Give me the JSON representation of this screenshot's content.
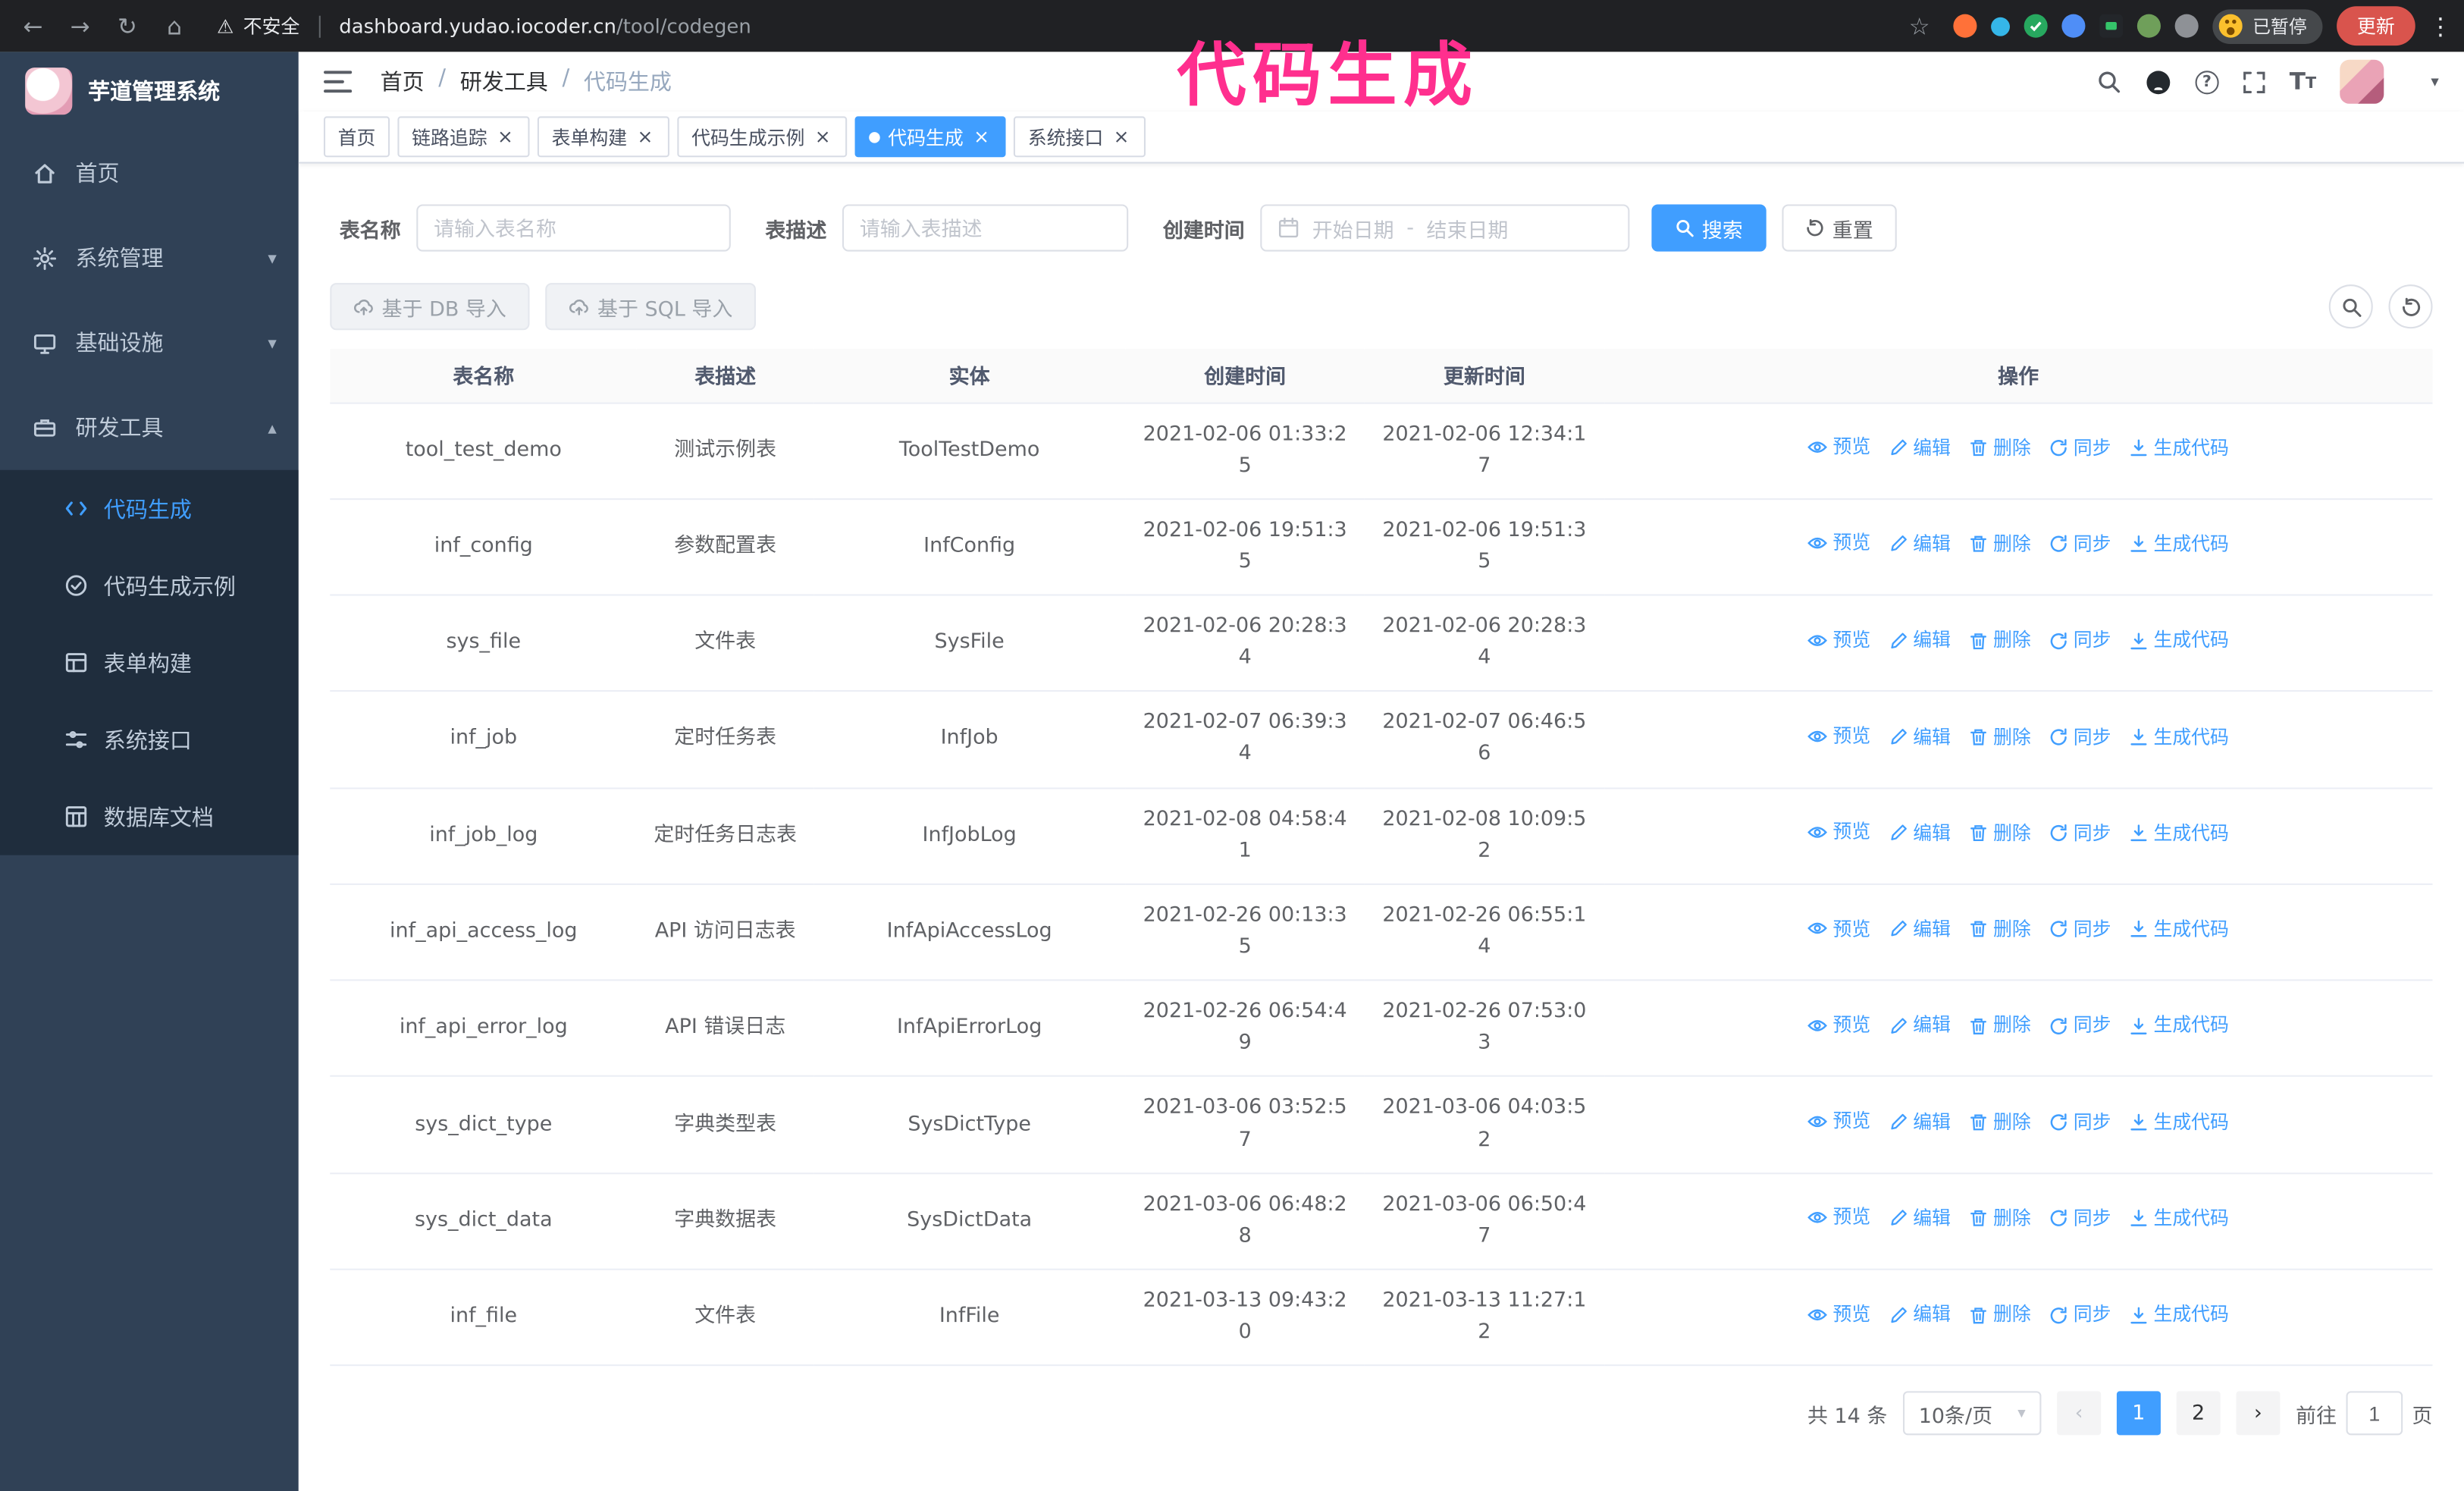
{
  "theme": {
    "accent_blue": "#409EFF",
    "sidebar_bg": "#304156",
    "submenu_bg": "#1f2d3d",
    "chrome_bg": "#202124",
    "overlay_pink": "#ff2f8e",
    "update_red": "#d9544d",
    "link_blue": "#409EFF"
  },
  "glyphs": {
    "back": "←",
    "forward": "→",
    "reload": "↻",
    "home": "⌂",
    "warning": "⚠",
    "star": "☆",
    "menu_dots": "⋮",
    "chevron_down": "▾",
    "chevron_up": "▴",
    "close": "×",
    "prev": "‹",
    "next": "›",
    "question": "?",
    "letter_t": "T"
  },
  "browser": {
    "security_label": "不安全",
    "url_host": "dashboard.yudao.iocoder.cn",
    "url_path": "/tool/codegen",
    "paused_badge": "已暂停",
    "update_button": "更新"
  },
  "overlay": {
    "title": "代码生成"
  },
  "sidebar": {
    "logo_title": "芋道管理系统",
    "items": [
      {
        "label": "首页",
        "icon": "home-icon"
      },
      {
        "label": "系统管理",
        "icon": "gear-icon"
      },
      {
        "label": "基础设施",
        "icon": "monitor-icon"
      },
      {
        "label": "研发工具",
        "icon": "toolbox-icon"
      }
    ],
    "sub_items": [
      {
        "label": "代码生成",
        "icon": "code-icon"
      },
      {
        "label": "代码生成示例",
        "icon": "circle-check-icon"
      },
      {
        "label": "表单构建",
        "icon": "form-icon"
      },
      {
        "label": "系统接口",
        "icon": "sliders-icon"
      },
      {
        "label": "数据库文档",
        "icon": "grid-icon"
      }
    ]
  },
  "header": {
    "breadcrumb": [
      "首页",
      "研发工具",
      "代码生成"
    ],
    "separator": "/"
  },
  "tabs": [
    {
      "label": "首页"
    },
    {
      "label": "链路追踪"
    },
    {
      "label": "表单构建"
    },
    {
      "label": "代码生成示例"
    },
    {
      "label": "代码生成"
    },
    {
      "label": "系统接口"
    }
  ],
  "filters": {
    "name_label": "表名称",
    "name_placeholder": "请输入表名称",
    "desc_label": "表描述",
    "desc_placeholder": "请输入表描述",
    "time_label": "创建时间",
    "start_placeholder": "开始日期",
    "range_separator": "-",
    "end_placeholder": "结束日期",
    "search_button": "搜索",
    "reset_button": "重置"
  },
  "toolbar": {
    "import_db": "基于 DB 导入",
    "import_sql": "基于 SQL 导入"
  },
  "table": {
    "columns": [
      "表名称",
      "表描述",
      "实体",
      "创建时间",
      "更新时间",
      "操作"
    ],
    "actions": [
      "预览",
      "编辑",
      "删除",
      "同步",
      "生成代码"
    ],
    "rows": [
      {
        "name": "tool_test_demo",
        "desc": "测试示例表",
        "entity": "ToolTestDemo",
        "created": "2021-02-06 01:33:25",
        "updated": "2021-02-06 12:34:17"
      },
      {
        "name": "inf_config",
        "desc": "参数配置表",
        "entity": "InfConfig",
        "created": "2021-02-06 19:51:35",
        "updated": "2021-02-06 19:51:35"
      },
      {
        "name": "sys_file",
        "desc": "文件表",
        "entity": "SysFile",
        "created": "2021-02-06 20:28:34",
        "updated": "2021-02-06 20:28:34"
      },
      {
        "name": "inf_job",
        "desc": "定时任务表",
        "entity": "InfJob",
        "created": "2021-02-07 06:39:34",
        "updated": "2021-02-07 06:46:56"
      },
      {
        "name": "inf_job_log",
        "desc": "定时任务日志表",
        "entity": "InfJobLog",
        "created": "2021-02-08 04:58:41",
        "updated": "2021-02-08 10:09:52"
      },
      {
        "name": "inf_api_access_log",
        "desc": "API 访问日志表",
        "entity": "InfApiAccessLog",
        "created": "2021-02-26 00:13:35",
        "updated": "2021-02-26 06:55:14"
      },
      {
        "name": "inf_api_error_log",
        "desc": "API 错误日志",
        "entity": "InfApiErrorLog",
        "created": "2021-02-26 06:54:49",
        "updated": "2021-02-26 07:53:03"
      },
      {
        "name": "sys_dict_type",
        "desc": "字典类型表",
        "entity": "SysDictType",
        "created": "2021-03-06 03:52:57",
        "updated": "2021-03-06 04:03:52"
      },
      {
        "name": "sys_dict_data",
        "desc": "字典数据表",
        "entity": "SysDictData",
        "created": "2021-03-06 06:48:28",
        "updated": "2021-03-06 06:50:47"
      },
      {
        "name": "inf_file",
        "desc": "文件表",
        "entity": "InfFile",
        "created": "2021-03-13 09:43:20",
        "updated": "2021-03-13 11:27:12"
      }
    ]
  },
  "pagination": {
    "total": "共 14 条",
    "page_size": "10条/页",
    "pages": [
      "1",
      "2"
    ],
    "goto_label": "前往",
    "goto_value": "1",
    "goto_unit": "页"
  }
}
